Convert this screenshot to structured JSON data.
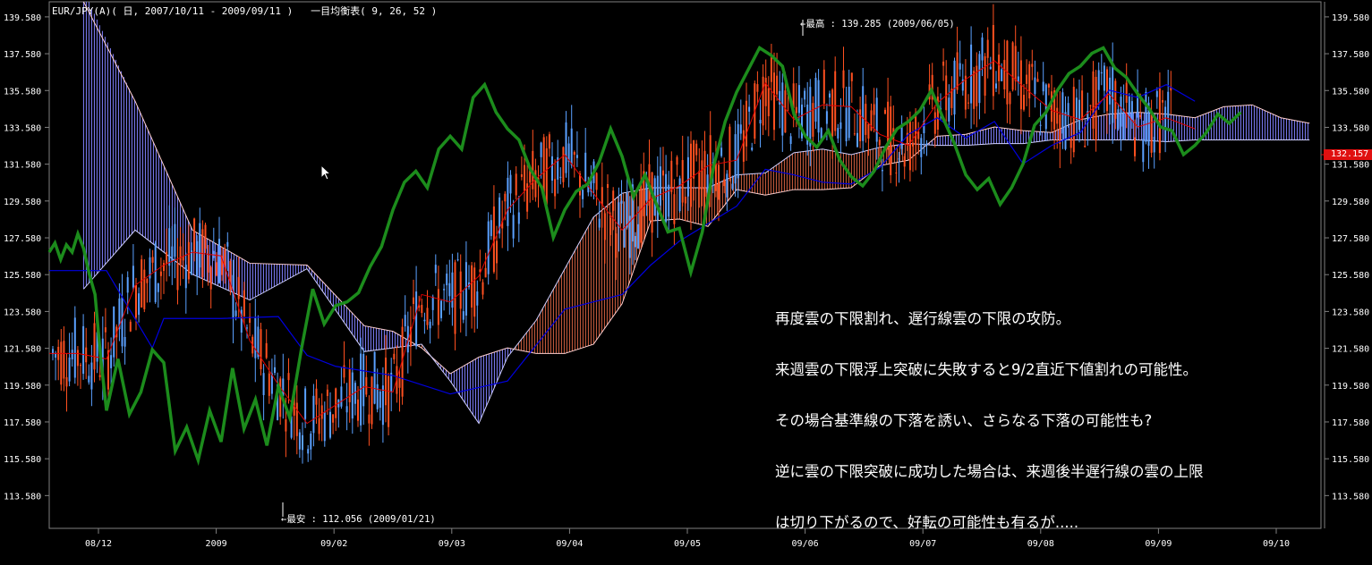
{
  "header": {
    "title": "EUR/JPY(A)( 日, 2007/10/11 - 2009/09/11 )   一目均衡表( 9, 26, 52 )"
  },
  "annotations": {
    "high": "←最高 : 139.285 (2009/06/05)",
    "low": "←最安 : 112.056 (2009/01/21)"
  },
  "note": {
    "lines": [
      "再度雲の下限割れ、遅行線雲の下限の攻防。",
      "来週雲の下限浮上突破に失敗すると9/2直近下値割れの可能性。",
      "その場合基準線の下落を誘い、さらなる下落の可能性も?",
      "逆に雲の下限突破に成功した場合は、来週後半遅行線の雲の上限",
      "は切り下がるので、好転の可能性も有るが....."
    ]
  },
  "current_price": "132.157",
  "colors": {
    "background": "#000000",
    "grid": "#808080",
    "up_candle": "#5aa0ff",
    "down_candle": "#ff5020",
    "chikou": "#1c8c1c",
    "kijun": "#0000e0",
    "tenkan": "#e00000",
    "kumo_bull": "#8080ff",
    "kumo_bear": "#d06040",
    "price_tag": "#e01010"
  },
  "chart_data": {
    "type": "line",
    "title": "EUR/JPY(A)( 日, 2007/10/11 - 2009/09/11 )   一目均衡表( 9, 26, 52 )",
    "y_ticks": [
      "139.580",
      "137.580",
      "135.580",
      "133.580",
      "131.580",
      "129.580",
      "127.580",
      "125.580",
      "123.580",
      "121.580",
      "119.580",
      "117.580",
      "115.580",
      "113.580"
    ],
    "x_ticks": [
      "08/12",
      "2009",
      "09/02",
      "09/03",
      "09/04",
      "09/05",
      "09/06",
      "09/07",
      "09/08",
      "09/09",
      "09/10"
    ],
    "ylim": [
      111.8,
      140.4
    ],
    "x_range_months": [
      0,
      22.2
    ],
    "series": [
      {
        "key": "chikou",
        "x": [
          0.0,
          0.1,
          0.2,
          0.3,
          0.4,
          0.5,
          0.6,
          0.7,
          0.8,
          0.9,
          1.0,
          1.2,
          1.4,
          1.6,
          1.8,
          2.0,
          2.2,
          2.4,
          2.6,
          2.8,
          3.0,
          3.2,
          3.4,
          3.6,
          3.8,
          4.0,
          4.2,
          4.4,
          4.6,
          4.8,
          5.0,
          5.2,
          5.4,
          5.6,
          5.8,
          6.0,
          6.2,
          6.4,
          6.6,
          6.8,
          7.0,
          7.2,
          7.4,
          7.6,
          7.8,
          8.0,
          8.2,
          8.4,
          8.6,
          8.8,
          9.0,
          9.2,
          9.4,
          9.6,
          9.8,
          10.0,
          10.2,
          10.4,
          10.6,
          10.8,
          11.0,
          11.2,
          11.4,
          11.6,
          11.8,
          12.0,
          12.2,
          12.4,
          12.6,
          12.8,
          13.0,
          13.2,
          13.4,
          13.6,
          13.8,
          14.0,
          14.2,
          14.4,
          14.6,
          14.8,
          15.0,
          15.2,
          15.4,
          15.6,
          15.8,
          16.0,
          16.2,
          16.4,
          16.6,
          16.8,
          17.0,
          17.2,
          17.4,
          17.6,
          17.8,
          18.0,
          18.2,
          18.4,
          18.6,
          18.8,
          19.0,
          19.2,
          19.4,
          19.6,
          19.8,
          20.0,
          20.2,
          20.4,
          20.6,
          20.8
        ],
        "values": [
          126.8,
          127.3,
          126.4,
          127.2,
          126.8,
          127.8,
          127.0,
          125.6,
          124.5,
          121.0,
          118.2,
          121.0,
          118.0,
          119.2,
          121.5,
          120.8,
          116.0,
          117.3,
          115.5,
          118.2,
          116.5,
          120.5,
          117.2,
          118.8,
          116.3,
          119.5,
          117.8,
          121.5,
          124.8,
          122.9,
          123.9,
          124.1,
          124.6,
          126.0,
          127.1,
          129.1,
          130.6,
          131.2,
          130.3,
          132.4,
          133.1,
          132.4,
          135.2,
          135.9,
          134.4,
          133.5,
          132.9,
          131.3,
          130.3,
          127.6,
          129.1,
          130.1,
          130.5,
          131.7,
          133.5,
          132.0,
          129.8,
          131.0,
          129.4,
          127.9,
          128.1,
          125.7,
          127.9,
          131.5,
          133.9,
          135.5,
          136.7,
          137.9,
          137.5,
          136.9,
          134.3,
          133.1,
          132.5,
          133.4,
          131.8,
          130.9,
          130.4,
          131.2,
          132.5,
          133.5,
          133.9,
          134.5,
          135.6,
          134.1,
          132.7,
          131.0,
          130.2,
          130.8,
          129.4,
          130.3,
          131.6,
          133.7,
          134.4,
          135.6,
          136.5,
          136.9,
          137.6,
          137.9,
          136.8,
          136.3,
          135.4,
          134.6,
          133.6,
          133.4,
          132.1,
          132.6,
          133.3,
          134.3,
          133.8,
          134.4
        ],
        "xlim_note": "months since Oct 2007"
      },
      {
        "key": "kijun",
        "x": [
          0.0,
          1.0,
          1.8,
          2.0,
          3.0,
          4.0,
          4.5,
          5.0,
          6.0,
          7.0,
          8.0,
          9.0,
          10.0,
          10.5,
          11.0,
          12.0,
          12.5,
          13.0,
          13.5,
          14.0,
          14.5,
          15.0,
          15.5,
          16.0,
          16.5,
          17.0,
          17.5,
          18.0,
          18.5,
          19.0,
          19.5,
          20.0
        ],
        "values": [
          125.8,
          125.8,
          121.6,
          123.2,
          123.2,
          123.3,
          121.2,
          120.6,
          120.1,
          119.1,
          119.8,
          123.7,
          124.5,
          126.1,
          127.4,
          129.3,
          131.3,
          131.0,
          130.6,
          130.5,
          131.4,
          133.2,
          134.1,
          133.0,
          133.9,
          131.6,
          132.6,
          133.3,
          135.6,
          135.2,
          135.9,
          135.0
        ]
      },
      {
        "key": "tenkan",
        "x": [
          0.0,
          0.5,
          1.0,
          1.5,
          2.0,
          2.5,
          3.0,
          3.5,
          4.0,
          4.5,
          5.0,
          5.5,
          6.0,
          6.5,
          7.0,
          7.5,
          8.0,
          8.5,
          9.0,
          9.5,
          10.0,
          10.5,
          11.0,
          11.5,
          12.0,
          12.5,
          13.0,
          13.5,
          14.0,
          14.5,
          15.0,
          15.5,
          16.0,
          16.5,
          17.0,
          17.5,
          18.0,
          18.5,
          19.0,
          19.5,
          20.0
        ],
        "values": [
          121.3,
          121.3,
          121.0,
          125.0,
          126.1,
          126.8,
          126.6,
          122.0,
          119.6,
          117.5,
          118.5,
          119.5,
          119.2,
          124.5,
          124.1,
          125.5,
          129.1,
          130.8,
          132.1,
          130.0,
          128.0,
          129.7,
          130.4,
          131.5,
          131.8,
          136.0,
          134.0,
          134.8,
          134.7,
          133.2,
          132.6,
          134.9,
          136.2,
          137.2,
          135.8,
          134.5,
          134.0,
          135.4,
          133.6,
          134.1,
          133.5
        ]
      },
      {
        "key": "senkou_a",
        "x": [
          0.6,
          1.5,
          2.5,
          3.5,
          4.5,
          5.5,
          6.0,
          6.5,
          7.0,
          7.5,
          8.0,
          8.5,
          9.0,
          9.5,
          10.0,
          10.5,
          11.0,
          11.5,
          12.0,
          12.5,
          13.0,
          13.5,
          14.0,
          14.5,
          15.0,
          15.5,
          16.0,
          16.5,
          17.0,
          17.5,
          18.0,
          18.5,
          19.0,
          19.5,
          20.0,
          20.5,
          21.0,
          21.5,
          22.0
        ],
        "values": [
          141.0,
          135.0,
          128.0,
          126.2,
          126.1,
          122.8,
          122.5,
          121.6,
          120.2,
          121.1,
          121.6,
          121.3,
          121.3,
          121.8,
          124.0,
          128.5,
          128.6,
          128.2,
          130.2,
          129.9,
          130.2,
          130.2,
          130.3,
          131.5,
          131.8,
          133.1,
          133.2,
          133.6,
          133.4,
          133.3,
          134.0,
          134.3,
          134.4,
          134.3,
          134.1,
          134.7,
          134.8,
          134.1,
          133.8
        ]
      },
      {
        "key": "senkou_b",
        "x": [
          0.6,
          1.5,
          2.5,
          3.5,
          4.5,
          5.5,
          6.0,
          6.5,
          7.0,
          7.5,
          8.0,
          8.5,
          9.0,
          9.5,
          10.0,
          10.5,
          11.0,
          11.5,
          12.0,
          12.5,
          13.0,
          13.5,
          14.0,
          14.5,
          15.0,
          15.5,
          16.0,
          16.5,
          17.0,
          17.5,
          18.0,
          18.5,
          19.0,
          19.5,
          20.0,
          20.5,
          21.0,
          21.5,
          22.0
        ],
        "values": [
          124.8,
          128.0,
          125.6,
          124.2,
          125.9,
          121.4,
          121.6,
          121.8,
          119.8,
          117.5,
          121.1,
          123.1,
          125.9,
          128.7,
          130.0,
          130.3,
          130.3,
          130.3,
          131.0,
          131.1,
          132.2,
          132.4,
          132.1,
          132.5,
          132.7,
          132.6,
          132.6,
          132.7,
          132.7,
          132.9,
          132.9,
          132.9,
          132.9,
          132.8,
          132.9,
          132.9,
          132.9,
          132.9,
          132.9
        ]
      }
    ],
    "candles_note": "daily OHLC bars, approx. 460 sessions (omitted; procedurally approximated)"
  }
}
